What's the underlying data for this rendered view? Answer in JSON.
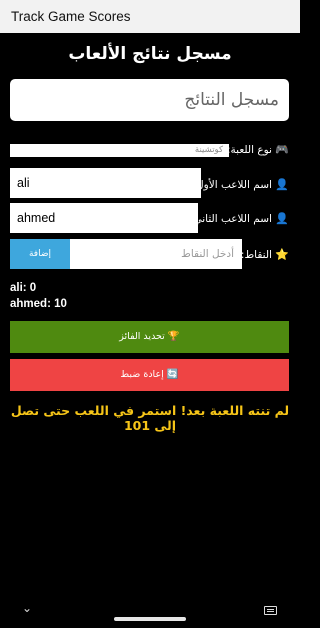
{
  "app_bar": {
    "title": "Track Game Scores"
  },
  "page": {
    "title": "مسجل نتائج الألعاب"
  },
  "results_box": {
    "text": "مسجل النتائج"
  },
  "game_type": {
    "label": "نوع اللعبة:",
    "icon": "🎮",
    "value": "كوتشينة"
  },
  "player1": {
    "label": "اسم اللاعب الأول:",
    "icon": "👤",
    "value": "ali"
  },
  "player2": {
    "label": "اسم اللاعب الثاني:",
    "icon": "👤",
    "value": "ahmed"
  },
  "points": {
    "label": "النقاط:",
    "icon": "⭐",
    "placeholder": "أدخل النقاط",
    "add_label": "إضافة"
  },
  "scores": [
    {
      "text": "ali: 0"
    },
    {
      "text": "ahmed: 10"
    }
  ],
  "buttons": {
    "determine_winner": "🏆 تحديد الفائز",
    "reset": "🔄 إعادة ضبط"
  },
  "status_message": "لم تنته اللعبة بعد! استمر في اللعب حتى تصل إلى 101",
  "colors": {
    "background": "#000000",
    "add_button": "#3ea7dd",
    "winner_button": "#4f8a10",
    "reset_button": "#ef4444",
    "status_text": "#f6c518"
  }
}
